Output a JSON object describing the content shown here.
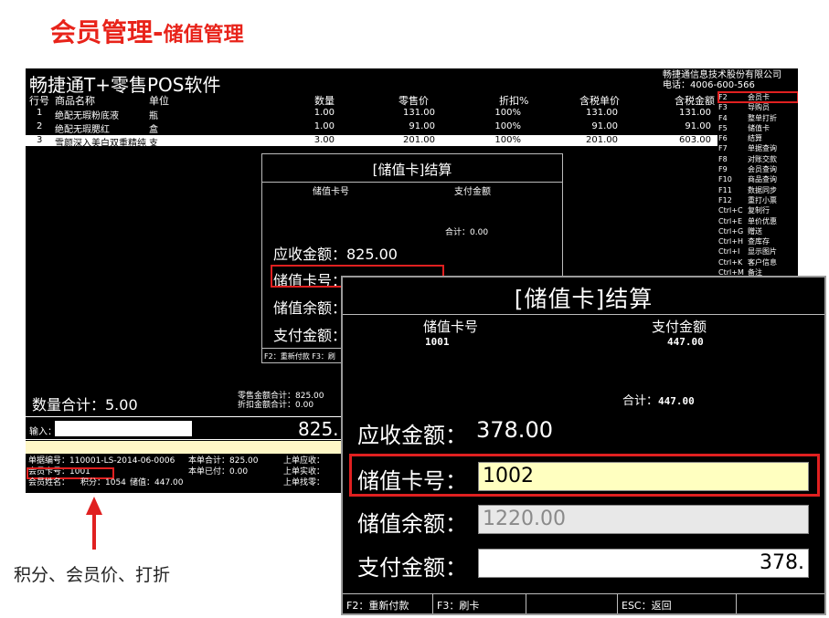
{
  "slide_title": {
    "main": "会员管理",
    "dash": "-",
    "sub": "储值管理"
  },
  "pos": {
    "title": "畅捷通T+零售POS软件",
    "company": "畅捷通信息技术股份有限公司",
    "phone": "电话：4006-600-566",
    "columns": [
      "行号",
      "商品名称",
      "单位",
      "数量",
      "零售价",
      "折扣%",
      "含税单价",
      "含税金额"
    ],
    "rows": [
      {
        "no": "1",
        "name": "绝配无瑕粉底液",
        "unit": "瓶",
        "qty": "1.00",
        "price": "131.00",
        "disc": "100%",
        "taxprice": "131.00",
        "amount": "131.00"
      },
      {
        "no": "2",
        "name": "绝配无瑕腮红",
        "unit": "盒",
        "qty": "1.00",
        "price": "91.00",
        "disc": "100%",
        "taxprice": "91.00",
        "amount": "91.00"
      },
      {
        "no": "3",
        "name": "雪颜深入美白双重精纯",
        "unit": "支",
        "qty": "3.00",
        "price": "201.00",
        "disc": "100%",
        "taxprice": "201.00",
        "amount": "603.00"
      }
    ],
    "fkeys": [
      {
        "key": "F2",
        "label": "会员卡"
      },
      {
        "key": "F3",
        "label": "导购员"
      },
      {
        "key": "F4",
        "label": "整单打折"
      },
      {
        "key": "F5",
        "label": "储值卡"
      },
      {
        "key": "F6",
        "label": "结算"
      },
      {
        "key": "F7",
        "label": "单据查询"
      },
      {
        "key": "F8",
        "label": "对账交款"
      },
      {
        "key": "F9",
        "label": "会员查询"
      },
      {
        "key": "F10",
        "label": "商品查询"
      },
      {
        "key": "F11",
        "label": "数据同步"
      },
      {
        "key": "F12",
        "label": "重打小票"
      },
      {
        "key": "Ctrl+C",
        "label": "复制行"
      },
      {
        "key": "Ctrl+E",
        "label": "单价优惠"
      },
      {
        "key": "Ctrl+G",
        "label": "赠送"
      },
      {
        "key": "Ctrl+H",
        "label": "查库存"
      },
      {
        "key": "Ctrl+I",
        "label": "显示图片"
      },
      {
        "key": "Ctrl+K",
        "label": "客户信息"
      },
      {
        "key": "Ctrl+M",
        "label": "备注"
      }
    ],
    "inner_dialog": {
      "title": "[储值卡]结算",
      "col_card": "储值卡号",
      "col_pay": "支付金额",
      "total": "合计：0.00",
      "receivable": "应收金额：825.00",
      "card_no": "储值卡号：",
      "balance": "储值余额：",
      "pay": "支付金额：",
      "footer": "F2：重新付款     F3：刷"
    },
    "qty_total": "数量合计：5.00",
    "sum_retail": "零售金额合计：825.00",
    "sum_discount": "折扣金额合计：0.00",
    "input_label": "输入：",
    "big_amount": "825.",
    "bill_no": "单据编号：110001-LS-2014-06-0006",
    "member_card": "会员卡号：1001",
    "member_name": "会员姓名：",
    "points": "积分：1054",
    "stored": "储值：447.00",
    "bill_total": "本单合计：825.00",
    "bill_paid": "本单已付：0.00",
    "last_receivable": "上单应收：",
    "last_paid": "上单实收：",
    "last_change": "上单找零："
  },
  "caption": "积分、会员价、打折",
  "dialog": {
    "title": "[储值卡]结算",
    "col_card": "储值卡号",
    "col_pay": "支付金额",
    "card_value": "1001",
    "pay_value": "447.00",
    "total_label": "合计：",
    "total_value": "447.00",
    "receivable_label": "应收金额：",
    "receivable_value": "378.00",
    "card_label": "储值卡号：",
    "card_input": "1002",
    "balance_label": "储值余额：",
    "balance_value": "1220.00",
    "pay_label": "支付金额：",
    "pay_input": "378.",
    "footer": [
      "F2：重新付款",
      "F3：刷卡",
      "",
      "ESC：返回",
      ""
    ]
  },
  "colors": {
    "accent_red": "#e02020",
    "title_red": "#e8231a",
    "card_input_bg": "#ffffc0"
  }
}
